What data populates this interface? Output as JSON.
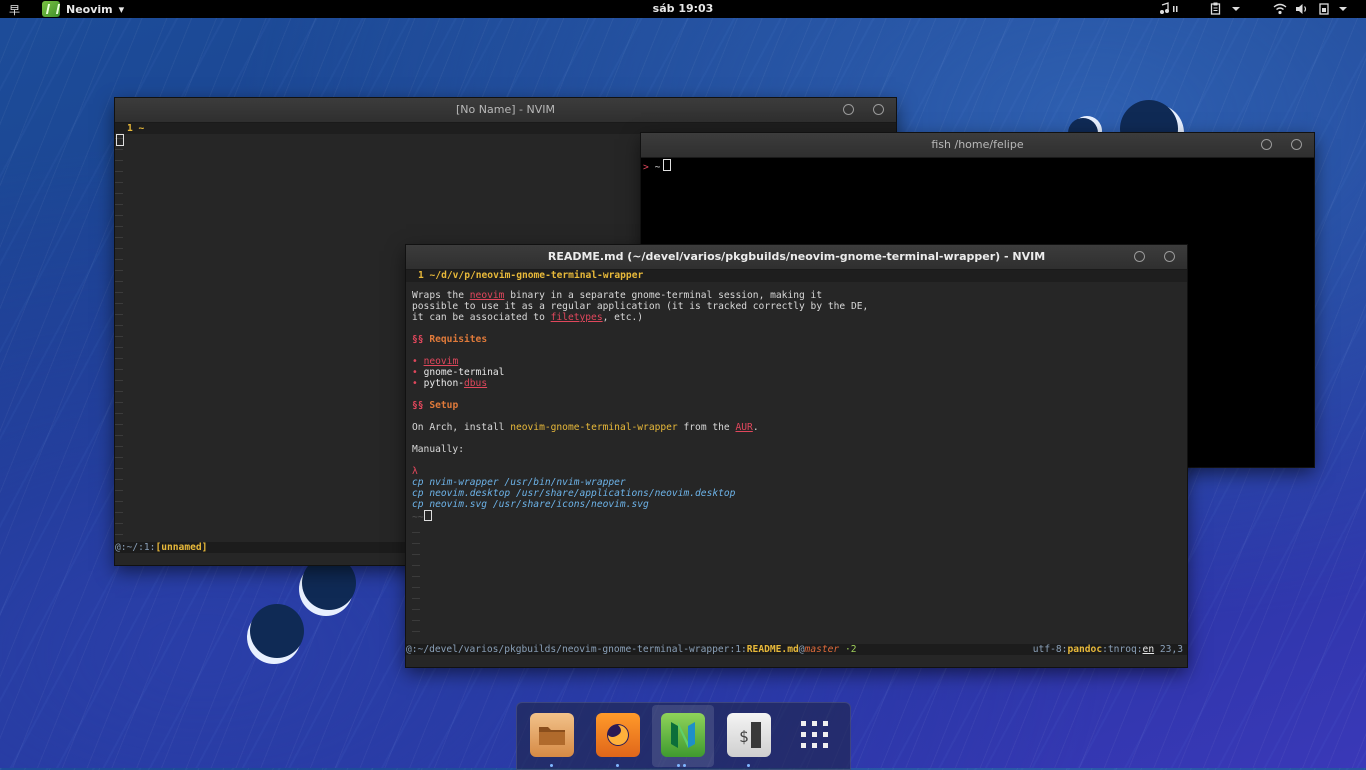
{
  "topbar": {
    "activities_glyph": "早",
    "app_name": "Neovim",
    "app_caret": "▾",
    "clock": "sáb 19:03",
    "tray": {
      "music_icon": "music-icon",
      "clipboard_icon": "clipboard-icon",
      "wifi_icon": "wifi-icon",
      "volume_icon": "volume-icon",
      "power_icon": "power-icon"
    }
  },
  "windows": {
    "nvim_blank": {
      "title": "[No Name] - NVIM",
      "tab_label": "1 ~",
      "status_prefix": "@:~/:1:",
      "status_file": "[unnamed]"
    },
    "fish": {
      "title": "fish  /home/felipe",
      "prompt_symbol": ">",
      "prompt_path": "~"
    },
    "readme": {
      "title": "README.md (~/devel/varios/pkgbuilds/neovim-gnome-terminal-wrapper) - NVIM",
      "tab_label": "1 ~/d/v/p/neovim-gnome-terminal-wrapper",
      "content": {
        "p1_a": "Wraps the ",
        "p1_link": "neovim",
        "p1_b": " binary in a separate gnome-terminal session, making it",
        "p1_line2": "possible to use it as a regular application (it is tracked correctly by the DE,",
        "p1_line3_a": "it can be associated to ",
        "p1_line3_link": "filetypes",
        "p1_line3_b": ", etc.)",
        "h1_marker": "§§",
        "h1": "Requisites",
        "bullet": "•",
        "req1": "neovim",
        "req2": "gnome-terminal",
        "req3_a": "python-",
        "req3_link": "dbus",
        "h2_marker": "§§",
        "h2": "Setup",
        "setup_a": "On Arch, install ",
        "setup_pkg": "neovim-gnome-terminal-wrapper",
        "setup_b": " from the ",
        "setup_link": "AUR",
        "setup_c": ".",
        "manually": "Manually:",
        "lambda": "λ",
        "cmd1": "cp nvim-wrapper /usr/bin/nvim-wrapper",
        "cmd2": "cp neovim.desktop /usr/share/applications/neovim.desktop",
        "cmd3": "cp neovim.svg /usr/share/icons/neovim.svg",
        "end_marker": "~~"
      },
      "status": {
        "path": "@:~/devel/varios/pkgbuilds/neovim-gnome-terminal-wrapper:1:",
        "file": "README.md",
        "at": "@",
        "branch": "master",
        "changes": " ·2",
        "encoding": "utf-8:",
        "filetype": "pandoc",
        "sep": ":",
        "textwidth": "tnroq",
        "sep2": ":",
        "spell": "en",
        "position": "23,3"
      }
    }
  },
  "dock": {
    "items": [
      {
        "name": "files-icon"
      },
      {
        "name": "firefox-icon"
      },
      {
        "name": "neovim-icon"
      },
      {
        "name": "terminal-icon"
      },
      {
        "name": "app-grid-icon"
      }
    ]
  }
}
